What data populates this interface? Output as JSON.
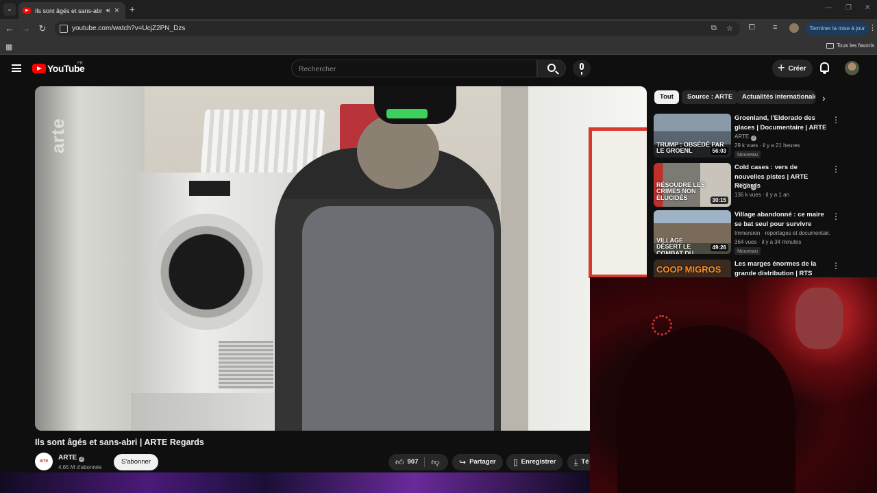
{
  "browser": {
    "tab_title": "Ils sont âgés et sans-abri | A",
    "url": "youtube.com/watch?v=UcjZ2PN_Dzs",
    "update_button": "Terminer la mise à jour",
    "bookmarks_folder": "Tous les favoris"
  },
  "youtube": {
    "logo_text": "YouTube",
    "region": "FR",
    "search_placeholder": "Rechercher",
    "create_label": "Créer"
  },
  "player": {
    "watermark": "arte"
  },
  "chips": [
    "Tout",
    "Source : ARTE",
    "Actualités internationales"
  ],
  "recommendations": [
    {
      "title": "Groenland, l'Eldorado des glaces | Documentaire | ARTE",
      "channel": "ARTE",
      "verified": true,
      "meta": "29 k vues · il y a 21 heures",
      "badge": "Nouveau",
      "duration": "56:03",
      "thumb_text": "TRUMP : OBSÉDÉ PAR LE GROENL"
    },
    {
      "title": "Cold cases : vers de nouvelles pistes | ARTE Regards",
      "channel": "ARTE",
      "verified": true,
      "meta": "136 k vues · il y a 1 an",
      "badge": "",
      "duration": "30:15",
      "thumb_text": "RÉSOUDRE LES CRIMES NON ÉLUCIDÉS"
    },
    {
      "title": "Village abandonné : ce maire se bat seul pour survivre",
      "channel": "Immersion · reportages et documentair...",
      "verified": false,
      "meta": "364 vues · il y a 34 minutes",
      "badge": "Nouveau",
      "duration": "49:26",
      "thumb_text": "VILLAGE DÉSERT LE COMBAT DU MAIRE"
    },
    {
      "title": "Les marges énormes de la grande distribution | RTS",
      "channel": "",
      "verified": false,
      "meta": "",
      "badge": "",
      "duration": "",
      "thumb_text": "COOP MIGROS"
    }
  ],
  "video": {
    "title": "Ils sont âgés et sans-abri | ARTE Regards",
    "channel_name": "ARTE",
    "channel_avatar_text": "arte",
    "subscribers": "4,65 M d'abonnés",
    "subscribe_label": "S'abonner",
    "likes": "907",
    "share_label": "Partager",
    "save_label": "Enregistrer",
    "download_label": "Té"
  },
  "colors": {
    "background": "#0f0f0f",
    "youtube_red": "#ff0000",
    "chip_bg": "#272727",
    "update_button_bg": "#1f3b5a"
  }
}
